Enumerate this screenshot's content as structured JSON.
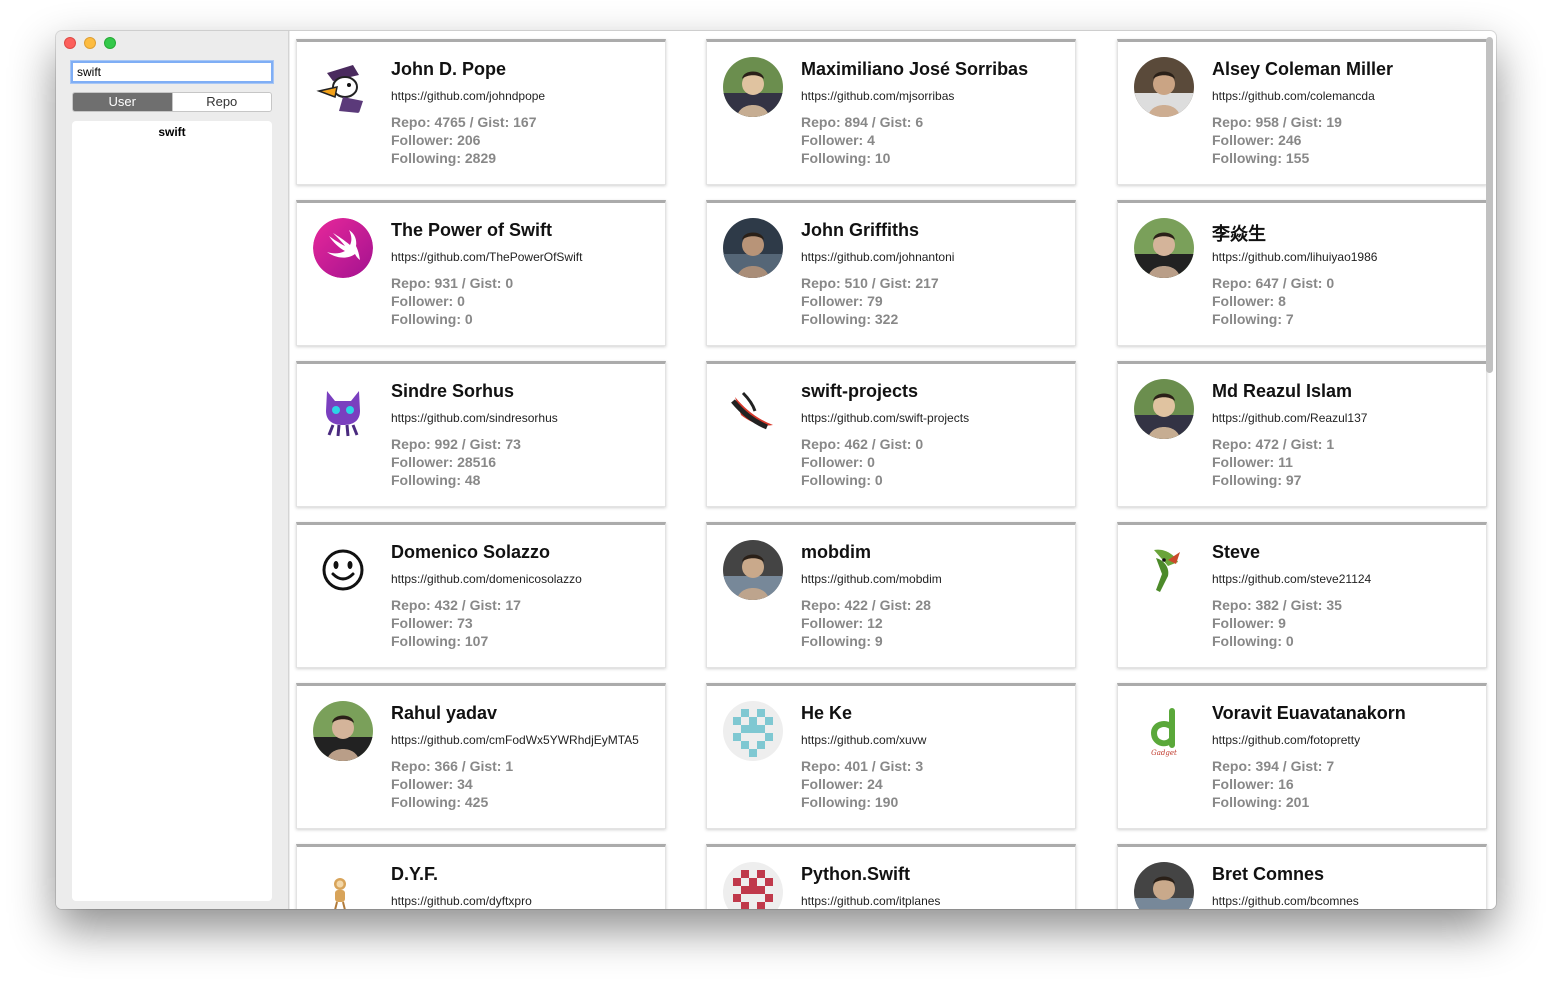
{
  "sidebar": {
    "search_value": "swift",
    "segments": [
      "User",
      "Repo"
    ],
    "history": [
      "swift"
    ]
  },
  "labels": {
    "repo": "Repo",
    "gist": "Gist",
    "follower": "Follower",
    "following": "Following"
  },
  "users": [
    {
      "name": "John D. Pope",
      "url": "https://github.com/johndpope",
      "repo": 4765,
      "gist": 167,
      "follower": 206,
      "following": 2829,
      "avatar": "duck-avatar"
    },
    {
      "name": "Maximiliano José Sorribas",
      "url": "https://github.com/mjsorribas",
      "repo": 894,
      "gist": 6,
      "follower": 4,
      "following": 10,
      "avatar": "photo-avatar"
    },
    {
      "name": "Alsey Coleman Miller",
      "url": "https://github.com/colemancda",
      "repo": 958,
      "gist": 19,
      "follower": 246,
      "following": 155,
      "avatar": "photo-avatar"
    },
    {
      "name": "The Power of Swift",
      "url": "https://github.com/ThePowerOfSwift",
      "repo": 931,
      "gist": 0,
      "follower": 0,
      "following": 0,
      "avatar": "swift-logo-avatar"
    },
    {
      "name": "John Griffiths",
      "url": "https://github.com/johnantoni",
      "repo": 510,
      "gist": 217,
      "follower": 79,
      "following": 322,
      "avatar": "photo-avatar"
    },
    {
      "name": "李焱生",
      "url": "https://github.com/lihuiyao1986",
      "repo": 647,
      "gist": 0,
      "follower": 8,
      "following": 7,
      "avatar": "photo-avatar"
    },
    {
      "name": "Sindre Sorhus",
      "url": "https://github.com/sindresorhus",
      "repo": 992,
      "gist": 73,
      "follower": 28516,
      "following": 48,
      "avatar": "cat-avatar"
    },
    {
      "name": "swift-projects",
      "url": "https://github.com/swift-projects",
      "repo": 462,
      "gist": 0,
      "follower": 0,
      "following": 0,
      "avatar": "bird-avatar"
    },
    {
      "name": "Md Reazul Islam",
      "url": "https://github.com/Reazul137",
      "repo": 472,
      "gist": 1,
      "follower": 11,
      "following": 97,
      "avatar": "photo-avatar"
    },
    {
      "name": "Domenico Solazzo",
      "url": "https://github.com/domenicosolazzo",
      "repo": 432,
      "gist": 17,
      "follower": 73,
      "following": 107,
      "avatar": "smiley-avatar"
    },
    {
      "name": "mobdim",
      "url": "https://github.com/mobdim",
      "repo": 422,
      "gist": 28,
      "follower": 12,
      "following": 9,
      "avatar": "photo-avatar"
    },
    {
      "name": "Steve",
      "url": "https://github.com/steve21124",
      "repo": 382,
      "gist": 35,
      "follower": 9,
      "following": 0,
      "avatar": "parrot-avatar"
    },
    {
      "name": "Rahul yadav",
      "url": "https://github.com/cmFodWx5YWRhdjEyMTA5",
      "repo": 366,
      "gist": 1,
      "follower": 34,
      "following": 425,
      "avatar": "photo-avatar"
    },
    {
      "name": "He Ke",
      "url": "https://github.com/xuvw",
      "repo": 401,
      "gist": 3,
      "follower": 24,
      "following": 190,
      "avatar": "identicon-avatar"
    },
    {
      "name": "Voravit Euavatanakorn",
      "url": "https://github.com/fotopretty",
      "repo": 394,
      "gist": 7,
      "follower": 16,
      "following": 201,
      "avatar": "logo-avatar"
    },
    {
      "name": "D.Y.F.",
      "url": "https://github.com/dyftxpro",
      "repo": null,
      "gist": null,
      "follower": null,
      "following": null,
      "avatar": "monkey-avatar"
    },
    {
      "name": "Python.Swift",
      "url": "https://github.com/itplanes",
      "repo": null,
      "gist": null,
      "follower": null,
      "following": null,
      "avatar": "identicon-avatar"
    },
    {
      "name": "Bret Comnes",
      "url": "https://github.com/bcomnes",
      "repo": null,
      "gist": null,
      "follower": null,
      "following": null,
      "avatar": "photo-avatar"
    }
  ],
  "colors": {
    "accent": "#7faef5",
    "segment_active": "#6f6f6f",
    "stat_text": "#888888",
    "card_top": "#ababab"
  }
}
